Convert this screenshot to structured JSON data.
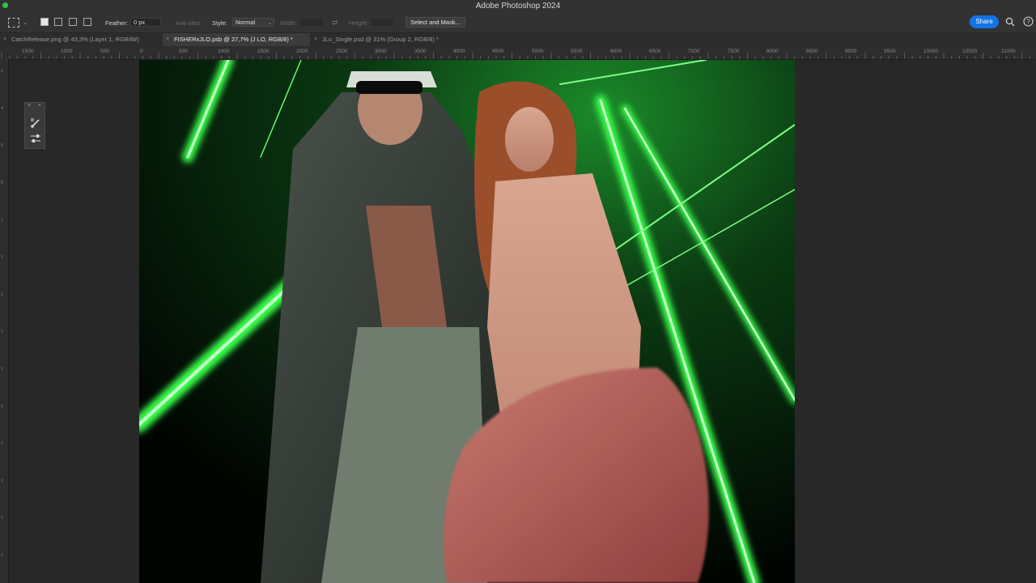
{
  "window": {
    "title": "Adobe Photoshop 2024"
  },
  "options_bar": {
    "feather_label": "Feather:",
    "feather_value": "0 px",
    "antialias_label": "Anti-alias",
    "style_label": "Style:",
    "style_value": "Normal",
    "width_label": "Width:",
    "height_label": "Height:",
    "select_mask_label": "Select and Mask..."
  },
  "share_label": "Share",
  "tabs": [
    {
      "label": "CatchRelease.png @ 43,3% (Layer 1, RGB/8#)"
    },
    {
      "label": "FISHERxJLO.psb @ 27,7% (J LO, RGB/8) *"
    },
    {
      "label": "JLo_Single.psd @ 31% (Group 2, RGB/8) *"
    }
  ],
  "ruler_h": [
    "1500",
    "1000",
    "500",
    "0",
    "500",
    "1000",
    "1500",
    "2000",
    "2500",
    "3000",
    "3500",
    "4000",
    "4500",
    "5000",
    "5500",
    "6000",
    "6500",
    "7000",
    "7500",
    "8000",
    "8500",
    "9000",
    "9500",
    "10000",
    "10500",
    "11000"
  ],
  "ruler_v": [
    "2",
    "4",
    "6",
    "8",
    "1",
    "1",
    "1",
    "1",
    "1",
    "2",
    "2",
    "2",
    "2",
    "2"
  ],
  "colors": {
    "accent": "#1473e6",
    "laser": "#39ff4a"
  },
  "icons": {
    "marquee": "rect-marquee-icon",
    "search": "search-icon",
    "help": "help-icon",
    "brush": "brush-icon",
    "sliders": "sliders-icon"
  }
}
